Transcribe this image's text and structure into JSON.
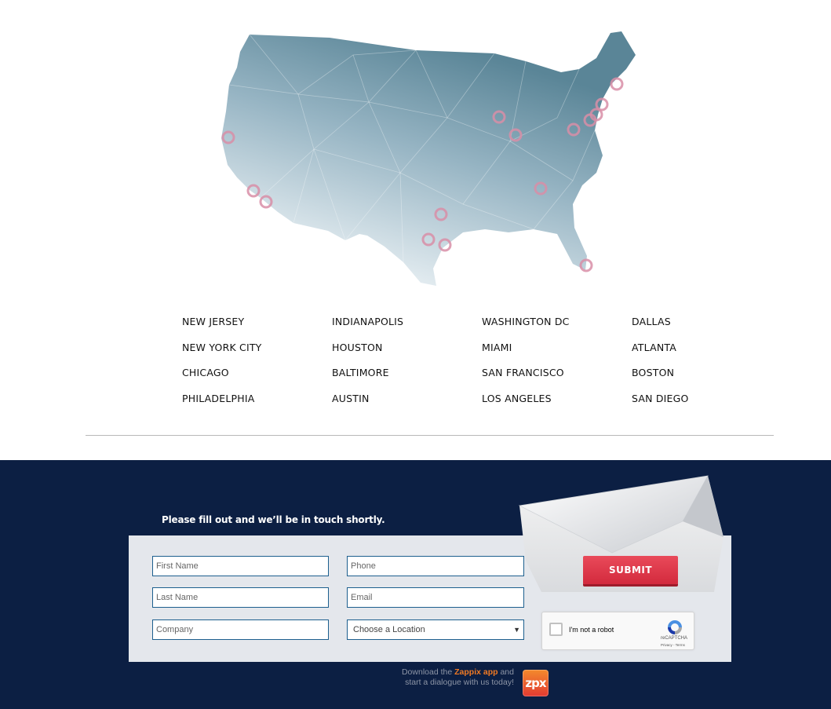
{
  "cities": [
    "NEW JERSEY",
    "INDIANAPOLIS",
    "WASHINGTON DC",
    "DALLAS",
    "NEW YORK CITY",
    "HOUSTON",
    "MIAMI",
    "ATLANTA",
    "CHICAGO",
    "BALTIMORE",
    "SAN FRANCISCO",
    "BOSTON",
    "PHILADELPHIA",
    "AUSTIN",
    "LOS ANGELES",
    "SAN DIEGO"
  ],
  "form": {
    "heading": "Please fill out and we’ll be in touch shortly.",
    "first_name_placeholder": "First Name",
    "last_name_placeholder": "Last Name",
    "company_placeholder": "Company",
    "phone_placeholder": "Phone",
    "email_placeholder": "Email",
    "location_selected": "Choose a Location",
    "submit_label": "SUBMIT"
  },
  "recaptcha": {
    "label": "I'm not a robot",
    "brand": "reCAPTCHA",
    "terms": "Privacy - Terms"
  },
  "app_promo": {
    "prefix": "Download the",
    "app_name": "Zappix app",
    "suffix": "and",
    "line2": "start a dialogue with us today!",
    "icon_text": "zpx"
  },
  "colors": {
    "footer_bg": "#0c1f43",
    "submit_red": "#e03a4b",
    "marker_pink": "#d88ea7",
    "accent_orange": "#f07a24"
  },
  "icons": {
    "map": "us-map-icon",
    "marker": "location-marker-icon",
    "envelope": "envelope-icon",
    "recaptcha": "recaptcha-icon",
    "app": "zappix-app-icon"
  }
}
